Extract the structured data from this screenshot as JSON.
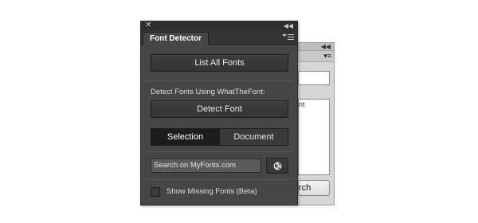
{
  "background_panel": {
    "collapse_icon": "double-chevron-left-icon",
    "menu_icon": "panel-menu-icon",
    "text_fragment": "nt",
    "button_fragment": "rch"
  },
  "panel": {
    "close_icon": "close-icon",
    "collapse_icon": "double-chevron-left-icon",
    "tab_label": "Font Detector",
    "menu_icon": "panel-menu-icon",
    "list_all_fonts_label": "List All Fonts",
    "detect_heading": "Detect Fonts Using WhatTheFont:",
    "detect_font_label": "Detect Font",
    "segment": {
      "options": [
        "Selection",
        "Document"
      ],
      "selected": "Selection"
    },
    "search": {
      "value": "Search on MyFonts.com",
      "icon": "globe-icon"
    },
    "show_missing_label": "Show Missing Fonts (Beta)",
    "show_missing_checked": false
  },
  "colors": {
    "panel_bg": "#464646",
    "titlebar_bg": "#2f2f2f",
    "button_bg": "#383838",
    "segment_active_bg": "#1d1d1d",
    "text": "#e8e8e8",
    "background_panel_bg": "#d6d6d6"
  }
}
